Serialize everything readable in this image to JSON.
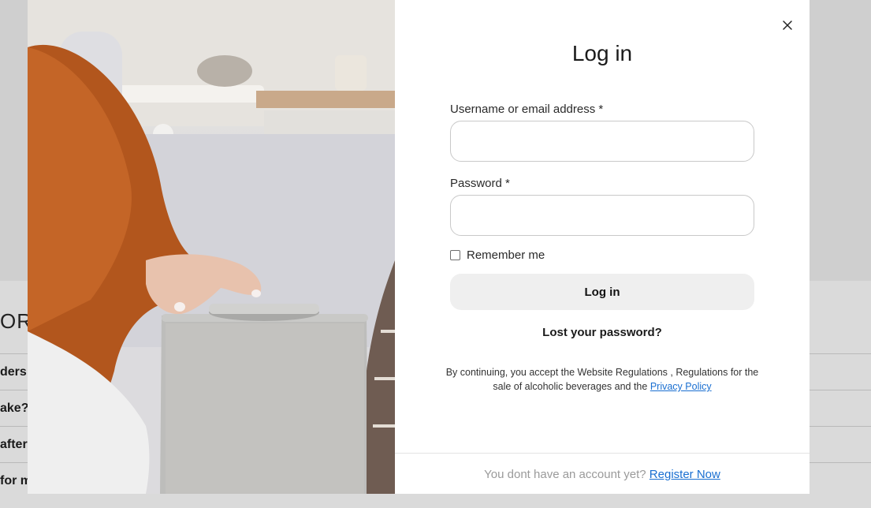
{
  "background_page": {
    "heading_fragment": "OR",
    "rows": [
      "ders f",
      "ake?",
      "after",
      "for m"
    ]
  },
  "modal": {
    "photo_alt": "Hand pressing smart speaker",
    "close_icon": "close-icon",
    "title": "Log in",
    "username_label": "Username or email address *",
    "username_value": "",
    "password_label": "Password *",
    "password_value": "",
    "remember_label": "Remember me",
    "remember_checked": false,
    "login_button": "Log in",
    "lost_password": "Lost your password?",
    "terms_text": "By continuing, you accept the Website Regulations , Regulations for the sale of alcoholic beverages and the",
    "privacy_link": "Privacy Policy",
    "footer_text": "You dont have an account yet?",
    "register_link": "Register Now"
  },
  "colors": {
    "link": "#1a6fd1",
    "button_bg": "#efefef",
    "input_border": "#c9c9c9"
  }
}
